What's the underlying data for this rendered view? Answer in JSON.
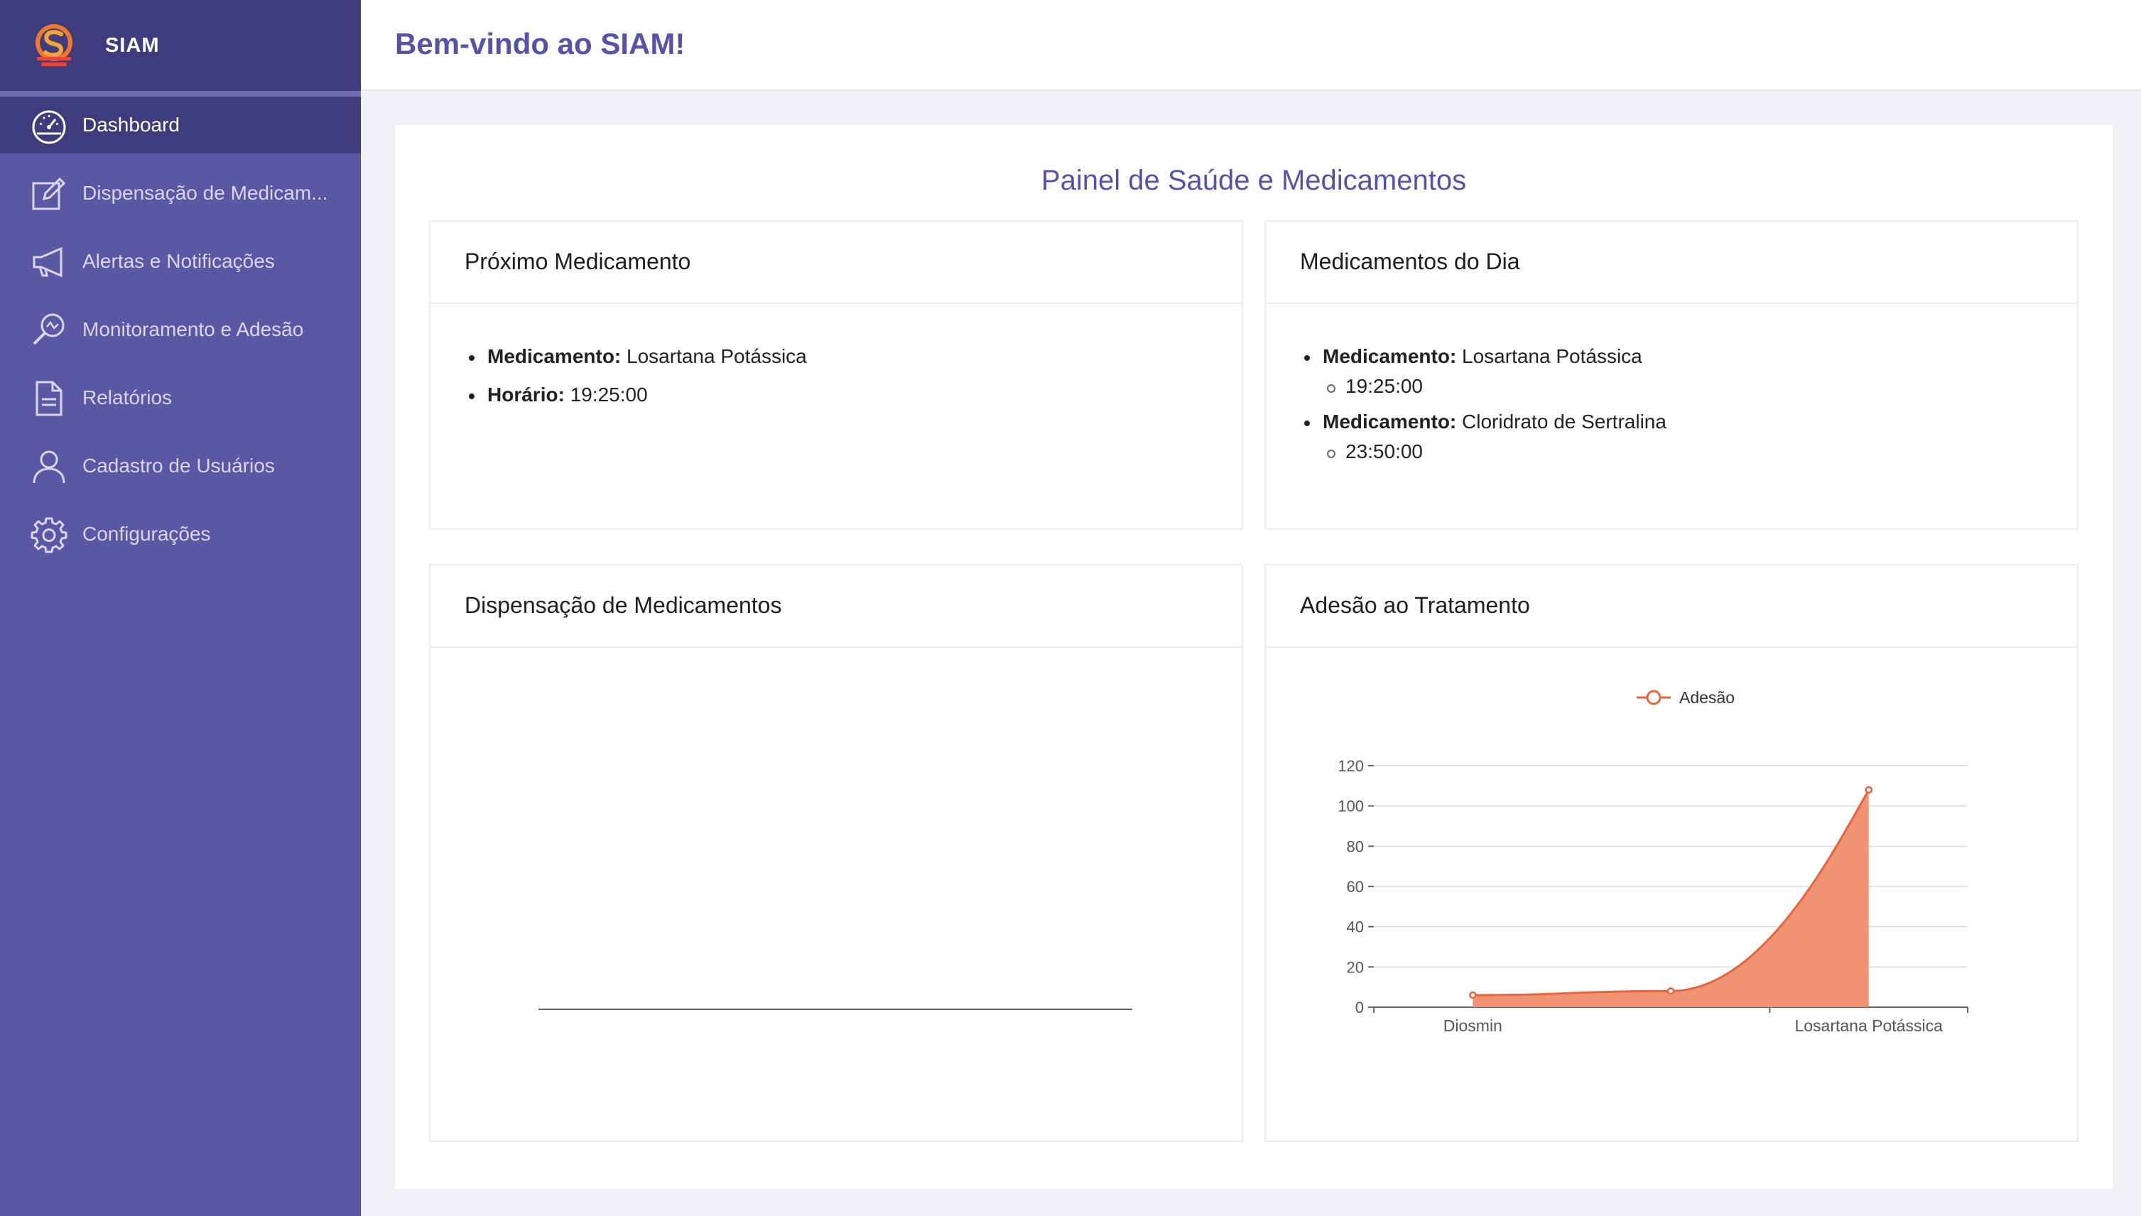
{
  "app": {
    "name": "SIAM"
  },
  "sidebar": {
    "items": [
      {
        "label": "Dashboard",
        "icon": "dashboard-gauge-icon",
        "active": true
      },
      {
        "label": "Dispensação de Medicam...",
        "icon": "edit-icon"
      },
      {
        "label": "Alertas e Notificações",
        "icon": "megaphone-icon"
      },
      {
        "label": "Monitoramento e Adesão",
        "icon": "magnifier-icon"
      },
      {
        "label": "Relatórios",
        "icon": "document-icon"
      },
      {
        "label": "Cadastro de Usuários",
        "icon": "user-icon"
      },
      {
        "label": "Configurações",
        "icon": "gear-icon"
      }
    ]
  },
  "header": {
    "title": "Bem-vindo ao SIAM!"
  },
  "main": {
    "title": "Painel de Saúde e Medicamentos",
    "next_med": {
      "title": "Próximo Medicamento",
      "med_label": "Medicamento:",
      "med_value": "Losartana Potássica",
      "time_label": "Horário:",
      "time_value": "19:25:00"
    },
    "today_meds": {
      "title": "Medicamentos do Dia",
      "items": [
        {
          "label": "Medicamento:",
          "name": "Losartana Potássica",
          "time": "19:25:00"
        },
        {
          "label": "Medicamento:",
          "name": "Cloridrato de Sertralina",
          "time": "23:50:00"
        }
      ]
    },
    "dispensation": {
      "title": "Dispensação de Medicamentos"
    },
    "adherence": {
      "title": "Adesão ao Tratamento"
    }
  },
  "colors": {
    "sidebar": "#5a57a3",
    "sidebar_dark": "#3f3c7d",
    "accent": "#5552a8",
    "series": "#e8643c",
    "series_fill": "#ef8d6c"
  },
  "chart_data": {
    "type": "area",
    "x": [
      "Diosmin",
      "",
      "Losartana Potássica"
    ],
    "xtick_labels": [
      "Diosmin",
      "Losartana Potássica"
    ],
    "series": [
      {
        "name": "Adesão",
        "values": [
          6,
          8,
          108
        ]
      }
    ],
    "ylim": [
      0,
      120
    ],
    "yticks": [
      0,
      20,
      40,
      60,
      80,
      100,
      120
    ],
    "legend": "top-center",
    "grid": true
  }
}
